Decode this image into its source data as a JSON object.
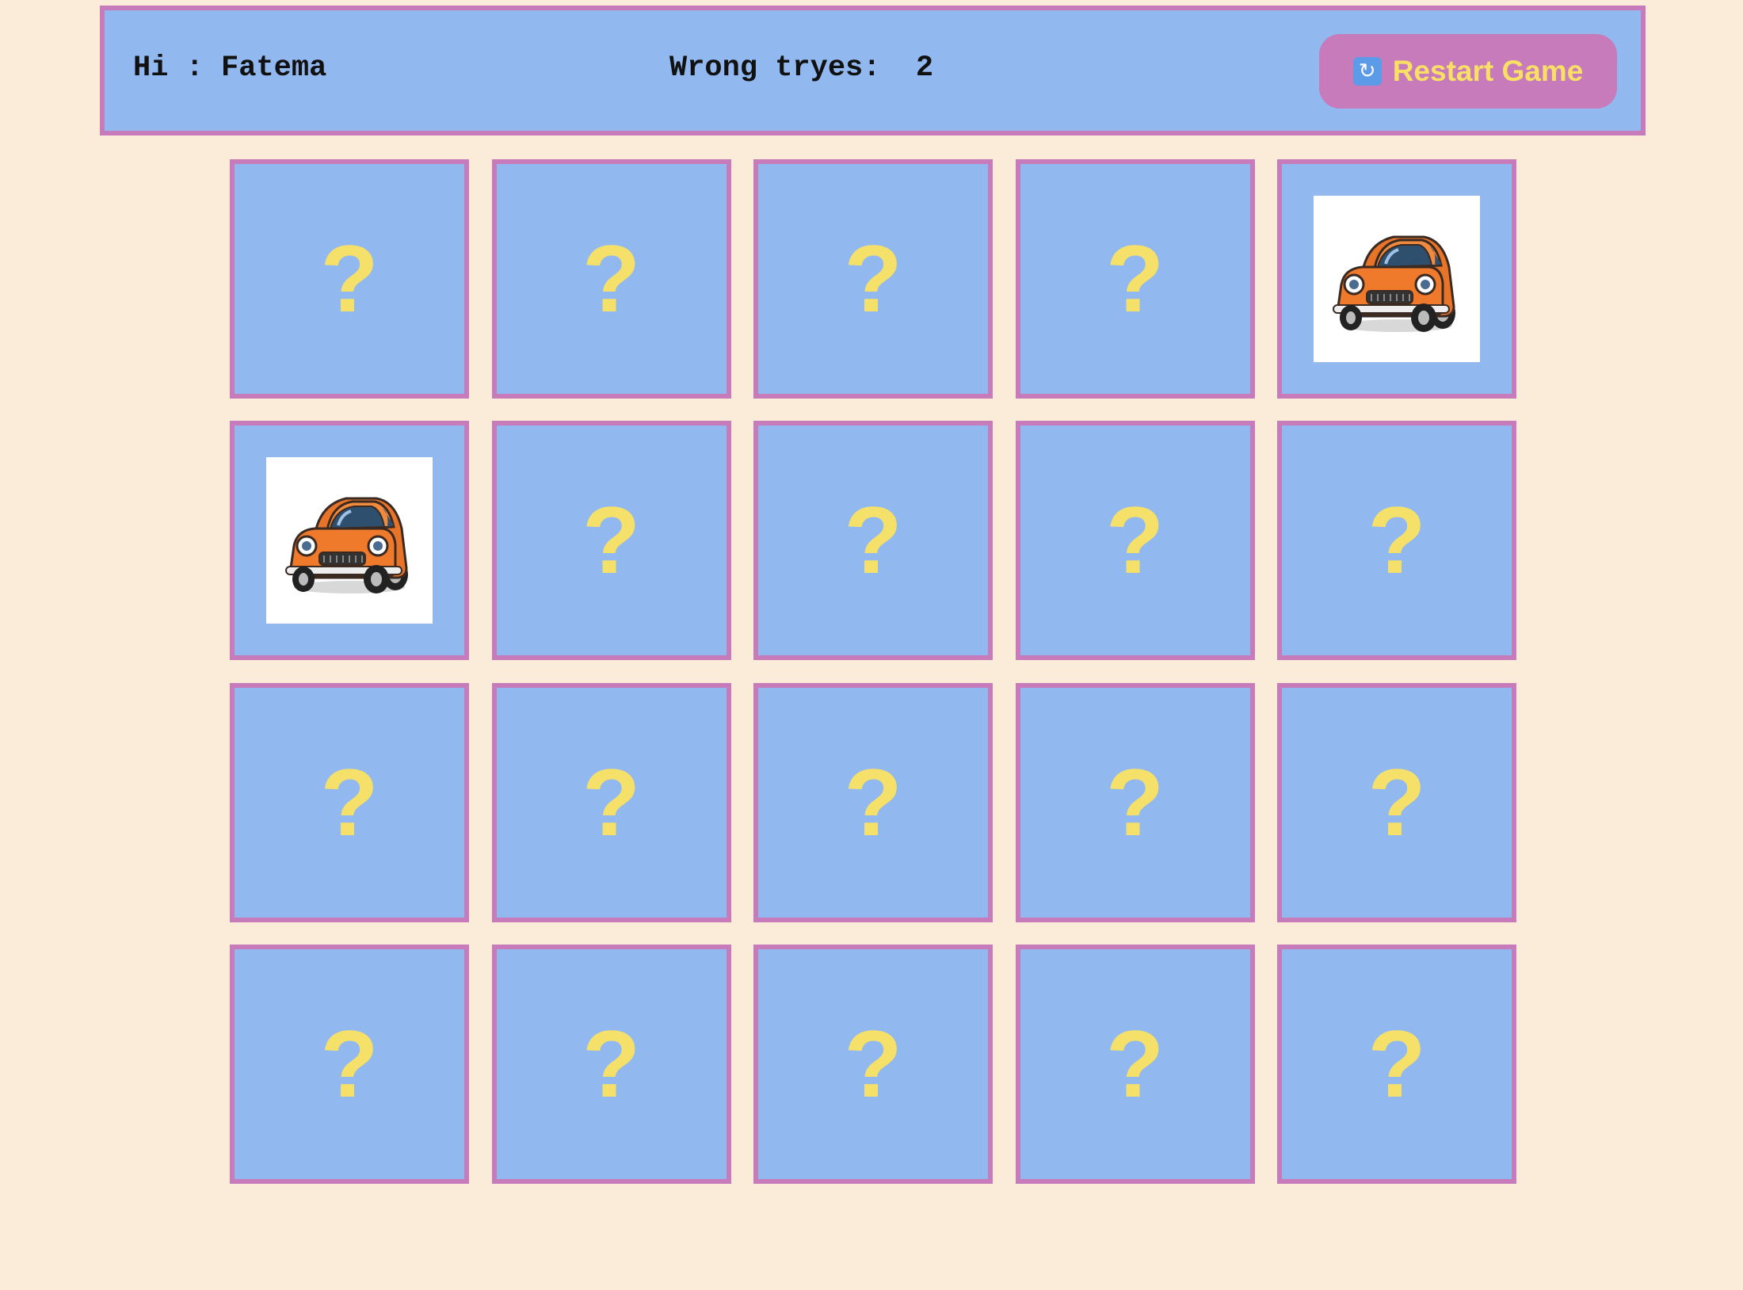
{
  "header": {
    "greeting_label": "Hi",
    "greeting_separator": " : ",
    "player_name": "Fatema",
    "wrong_label": "Wrong tryes:",
    "wrong_count": "2",
    "restart_icon": "refresh-icon",
    "restart_label": "Restart Game"
  },
  "board": {
    "rows": 4,
    "cols": 5,
    "hidden_symbol": "?",
    "cards": [
      {
        "state": "hidden"
      },
      {
        "state": "hidden"
      },
      {
        "state": "hidden"
      },
      {
        "state": "hidden"
      },
      {
        "state": "revealed",
        "image": "car-icon"
      },
      {
        "state": "revealed",
        "image": "car-icon"
      },
      {
        "state": "hidden"
      },
      {
        "state": "hidden"
      },
      {
        "state": "hidden"
      },
      {
        "state": "hidden"
      },
      {
        "state": "hidden"
      },
      {
        "state": "hidden"
      },
      {
        "state": "hidden"
      },
      {
        "state": "hidden"
      },
      {
        "state": "hidden"
      },
      {
        "state": "hidden"
      },
      {
        "state": "hidden"
      },
      {
        "state": "hidden"
      },
      {
        "state": "hidden"
      },
      {
        "state": "hidden"
      }
    ]
  },
  "colors": {
    "background": "#fbebd9",
    "panel": "#91b8ef",
    "border": "#c77bbb",
    "accent_yellow": "#f5e06a",
    "car_body": "#ef7a2c"
  }
}
